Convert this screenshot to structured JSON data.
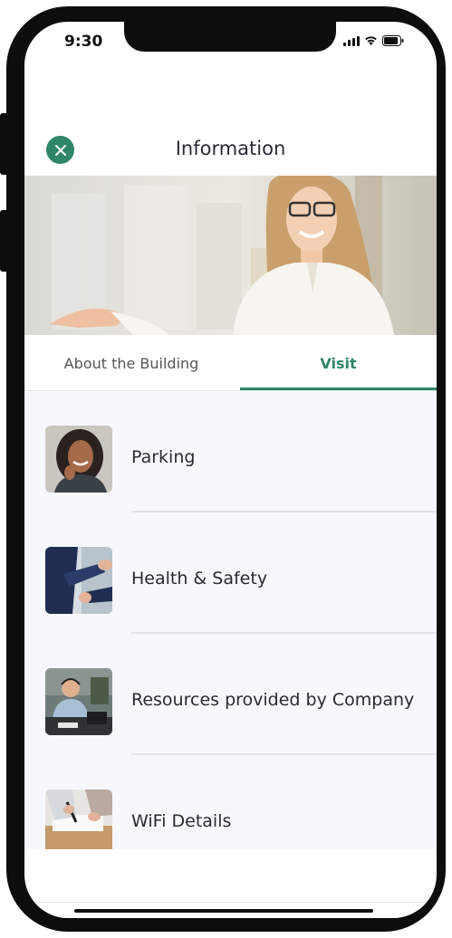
{
  "status_bar": {
    "time": "9:30"
  },
  "header": {
    "title": "Information",
    "close_icon": "close-icon"
  },
  "tabs": [
    {
      "label": "About the Building",
      "active": false
    },
    {
      "label": "Visit",
      "active": true
    }
  ],
  "list": {
    "items": [
      {
        "label": "Parking",
        "thumbnail": "smiling-woman-photo"
      },
      {
        "label": "Health & Safety",
        "thumbnail": "handshake-photo"
      },
      {
        "label": "Resources provided by Company",
        "thumbnail": "man-with-headset-photo"
      },
      {
        "label": "WiFi Details",
        "thumbnail": "signing-document-photo"
      }
    ]
  },
  "colors": {
    "accent": "#2e8568",
    "list_background": "#f7f8fc",
    "frame": "#0d0d0d"
  }
}
